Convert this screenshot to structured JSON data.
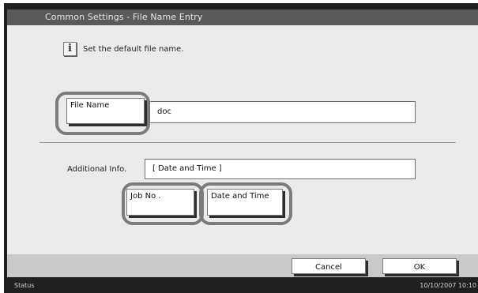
{
  "header": {
    "title": "Common Settings - File Name Entry"
  },
  "message": {
    "icon": "info-icon",
    "icon_glyph": "i",
    "text": "Set the default file name."
  },
  "file_name": {
    "button_label": "File Name",
    "value": "doc"
  },
  "additional_info": {
    "label": "Additional Info.",
    "value": "[ Date and Time ]",
    "job_no_label": "Job No .",
    "date_time_label": "Date and Time"
  },
  "footer": {
    "cancel_label": "Cancel",
    "ok_label": "OK"
  },
  "statusbar": {
    "status_label": "Status",
    "datetime": "10/10/2007   10:10"
  },
  "colors": {
    "frame": "#202020",
    "titlebar": "#5a5a5a",
    "content": "#ebebeb",
    "highlight_ring": "#7b7b7b"
  }
}
